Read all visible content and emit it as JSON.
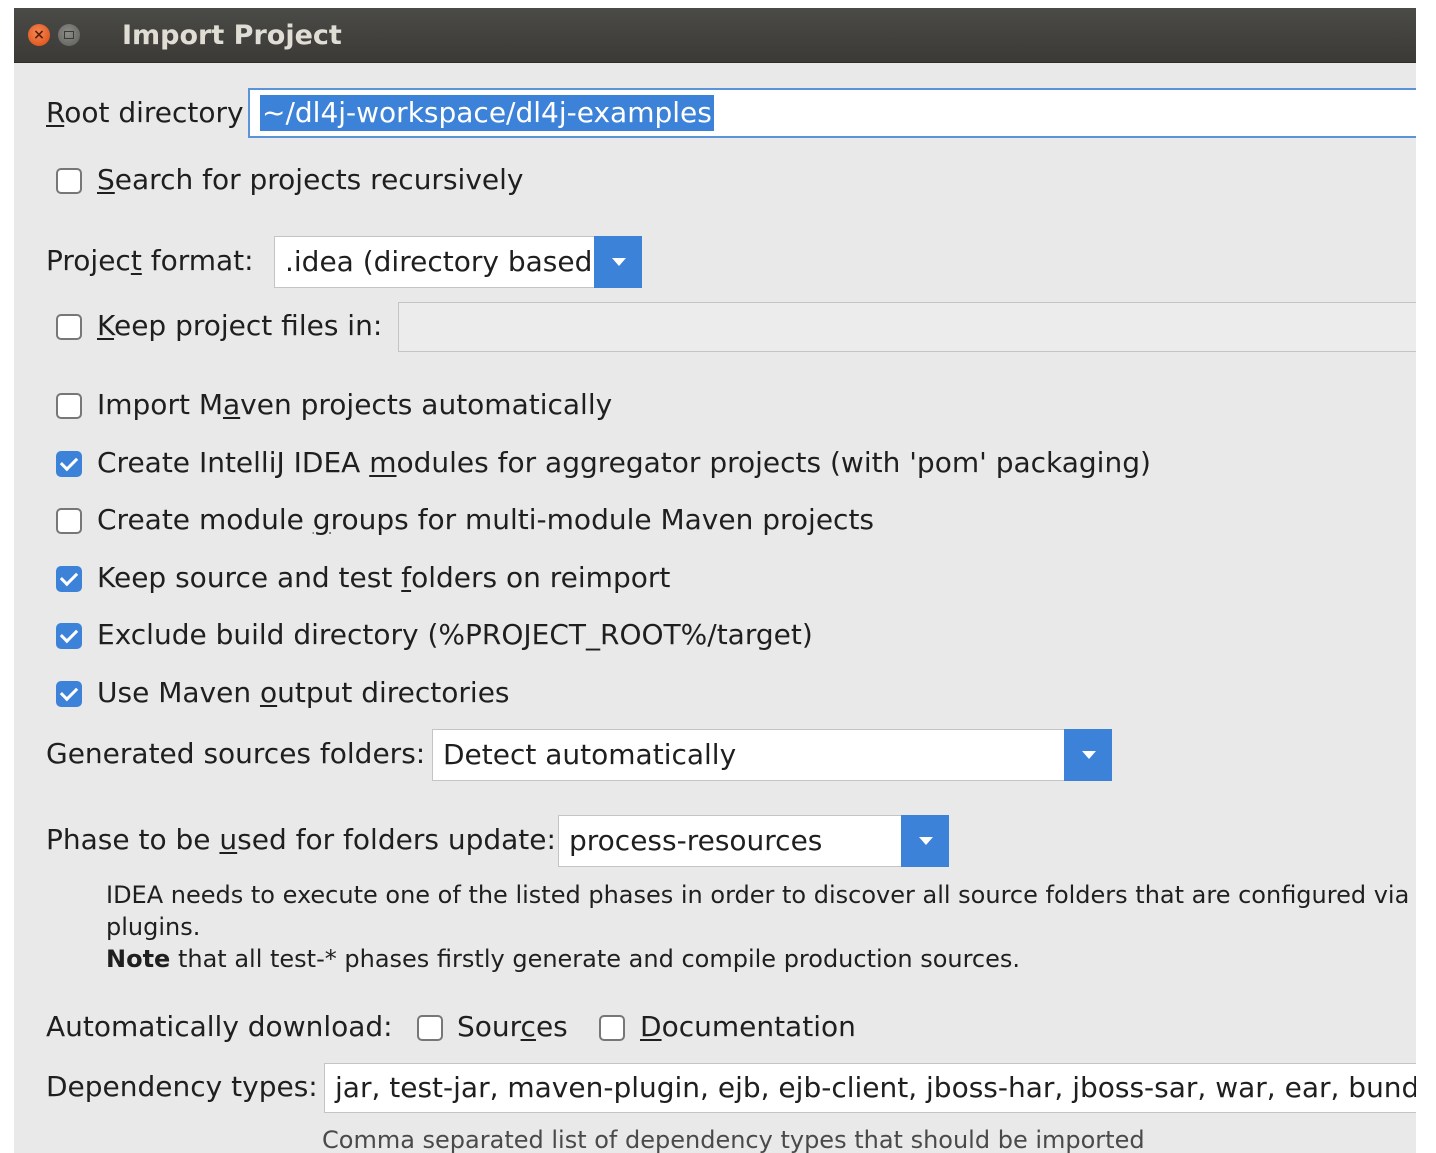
{
  "window": {
    "title": "Import Project"
  },
  "root_directory": {
    "label_mnemonic": "R",
    "label_rest": "oot directory",
    "value": "~/dl4j-workspace/dl4j-examples"
  },
  "search_recursive": {
    "checked": false,
    "mnemonic": "S",
    "rest": "earch for projects recursively"
  },
  "project_format": {
    "label_pre": "Projec",
    "mnemonic": "t",
    "label_post": " format:",
    "value": ".idea (directory based)"
  },
  "keep_project_files": {
    "checked": false,
    "mnemonic": "K",
    "rest": "eep project files in:",
    "value": ""
  },
  "options": [
    {
      "pre": "Import M",
      "mnemonic": "a",
      "post": "ven projects automatically",
      "checked": false
    },
    {
      "pre": "Create IntelliJ IDEA ",
      "mnemonic": "m",
      "post": "odules for aggregator projects (with 'pom' packaging)",
      "checked": true
    },
    {
      "pre": "Create module ",
      "mnemonic": "g",
      "post": "roups for multi-module Maven projects",
      "checked": false
    },
    {
      "pre": "Keep source and test ",
      "mnemonic": "f",
      "post": "olders on reimport",
      "checked": true
    },
    {
      "pre": "Exclude build directory (%PROJECT_ROOT%/target)",
      "mnemonic": "",
      "post": "",
      "checked": true
    },
    {
      "pre": "Use Maven ",
      "mnemonic": "o",
      "post": "utput directories",
      "checked": true
    }
  ],
  "generated_sources": {
    "label": "Generated sources folders:",
    "value": "Detect automatically"
  },
  "phase": {
    "label_pre": "Phase to be ",
    "mnemonic": "u",
    "label_post": "sed for folders update:",
    "value": "process-resources"
  },
  "phase_note": {
    "line1": "IDEA needs to execute one of the listed phases in order to discover all source folders that are configured via Maven",
    "line2": "plugins.",
    "line3_bold": "Note",
    "line3_rest": " that all test-* phases firstly generate and compile production sources."
  },
  "auto_download": {
    "label": "Automatically download:",
    "sources": {
      "pre": "Sour",
      "mnemonic": "c",
      "post": "es",
      "checked": false
    },
    "documentation": {
      "pre": "",
      "mnemonic": "D",
      "post": "ocumentation",
      "checked": false
    }
  },
  "dependency_types": {
    "label": "Dependency types:",
    "value": "jar, test-jar, maven-plugin, ejb, ejb-client, jboss-har, jboss-sar, war, ear, bundle",
    "hint": "Comma separated list of dependency types that should be imported"
  }
}
